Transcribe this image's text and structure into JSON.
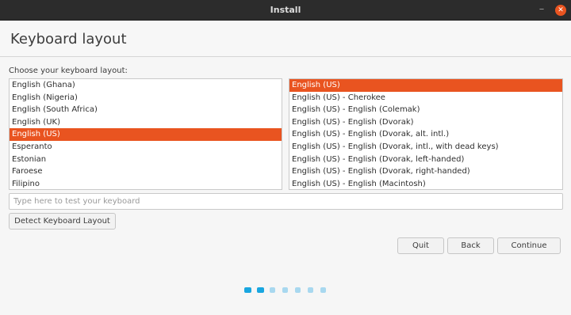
{
  "window": {
    "title": "Install",
    "minimize_glyph": "–",
    "close_glyph": "✕"
  },
  "page": {
    "title": "Keyboard layout",
    "choose_label": "Choose your keyboard layout:"
  },
  "layouts": [
    {
      "label": "English (Ghana)",
      "selected": false
    },
    {
      "label": "English (Nigeria)",
      "selected": false
    },
    {
      "label": "English (South Africa)",
      "selected": false
    },
    {
      "label": "English (UK)",
      "selected": false
    },
    {
      "label": "English (US)",
      "selected": true
    },
    {
      "label": "Esperanto",
      "selected": false
    },
    {
      "label": "Estonian",
      "selected": false
    },
    {
      "label": "Faroese",
      "selected": false
    },
    {
      "label": "Filipino",
      "selected": false
    }
  ],
  "variants": [
    {
      "label": "English (US)",
      "selected": true
    },
    {
      "label": "English (US) - Cherokee",
      "selected": false
    },
    {
      "label": "English (US) - English (Colemak)",
      "selected": false
    },
    {
      "label": "English (US) - English (Dvorak)",
      "selected": false
    },
    {
      "label": "English (US) - English (Dvorak, alt. intl.)",
      "selected": false
    },
    {
      "label": "English (US) - English (Dvorak, intl., with dead keys)",
      "selected": false
    },
    {
      "label": "English (US) - English (Dvorak, left-handed)",
      "selected": false
    },
    {
      "label": "English (US) - English (Dvorak, right-handed)",
      "selected": false
    },
    {
      "label": "English (US) - English (Macintosh)",
      "selected": false
    }
  ],
  "test_input": {
    "value": "",
    "placeholder": "Type here to test your keyboard"
  },
  "buttons": {
    "detect": "Detect Keyboard Layout",
    "quit": "Quit",
    "back": "Back",
    "continue": "Continue"
  },
  "progress": {
    "total_steps": 7,
    "completed_steps": 2
  },
  "colors": {
    "accent": "#e95420",
    "titlebar": "#2c2c2c",
    "progress_active": "#19a6e0",
    "progress_inactive": "#a8d8ef"
  }
}
